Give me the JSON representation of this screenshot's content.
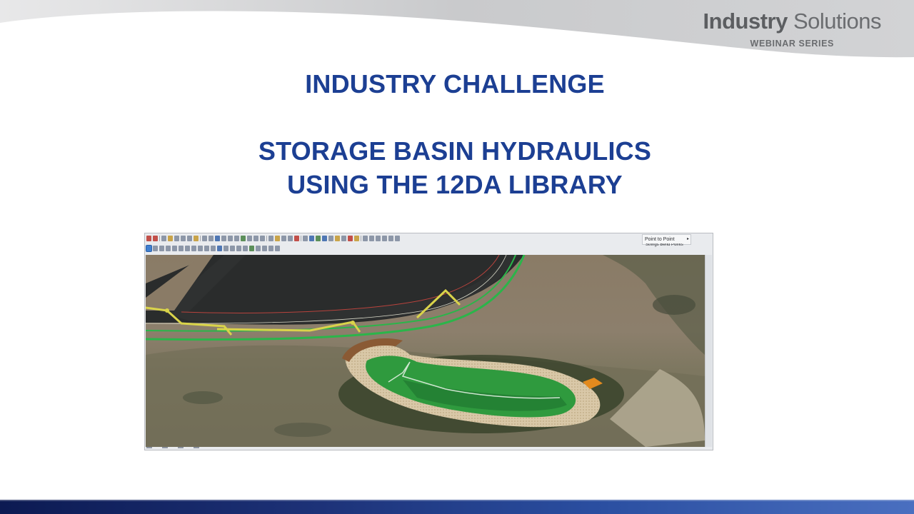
{
  "brand": {
    "name_bold": "Industry",
    "name_light": "Solutions",
    "tagline": "WEBINAR SERIES"
  },
  "slide": {
    "heading": "INDUSTRY CHALLENGE",
    "subtitle_line1": "STORAGE BASIN HYDRAULICS",
    "subtitle_line2": "USING THE 12DA LIBRARY"
  },
  "app_window": {
    "mode_dropdown": "Point to Point",
    "mode_dropdown_secondary": "Strings Bend Points"
  },
  "colors": {
    "title_blue": "#1c3f93",
    "footer_blue": "#1d3278",
    "road_green": "#2bb54a",
    "road_yellow": "#d9d34a",
    "basin_green": "#2f9a3e"
  }
}
